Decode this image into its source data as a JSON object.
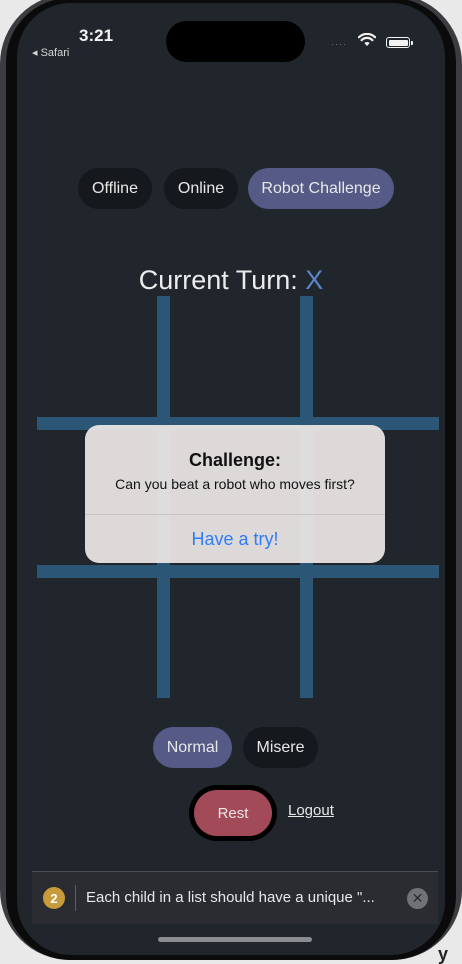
{
  "status_bar": {
    "time": "3:21",
    "back_label": "◂ Safari",
    "signal_glyph": "····"
  },
  "modes": {
    "offline": "Offline",
    "online": "Online",
    "robot": "Robot Challenge",
    "active": "Robot Challenge"
  },
  "turn": {
    "label": "Current Turn:",
    "mark": "X"
  },
  "board": {
    "cells": [
      "",
      "",
      "",
      "",
      "",
      "",
      "",
      "",
      ""
    ]
  },
  "alert": {
    "title": "Challenge:",
    "message": "Can you beat a robot who moves first?",
    "action": "Have a try!"
  },
  "variants": {
    "normal": "Normal",
    "misere": "Misere",
    "active": "Normal"
  },
  "controls": {
    "rest": "Rest",
    "logout": "Logout"
  },
  "toast": {
    "count": "2",
    "message": "Each child in a list should have a unique \"...",
    "close_glyph": "✕"
  },
  "corner_text": "y h",
  "colors": {
    "background": "#21262d",
    "pill": "#15191e",
    "pill_active": "#555a86",
    "grid": "#2c5676",
    "turn_mark": "#5d84c9",
    "rest": "#a24a58",
    "alert_action": "#2f7cf6",
    "toast_badge": "#c99a3c"
  }
}
